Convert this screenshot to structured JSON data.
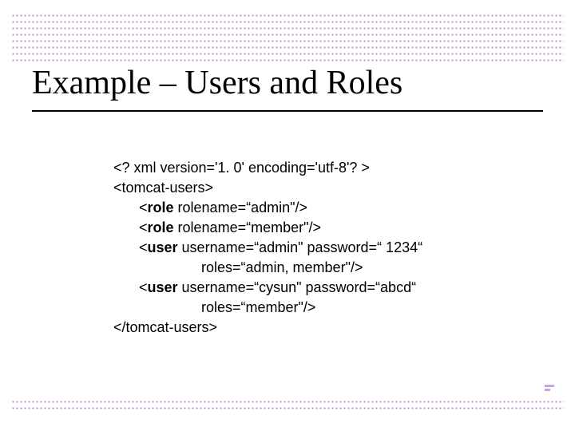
{
  "title": "Example – Users and Roles",
  "code": {
    "l1": "<? xml version='1. 0' encoding='utf-8'? >",
    "l2": "<tomcat-users>",
    "l3_pre": "<",
    "l3_b": "role",
    "l3_post": " rolename=“admin\"/>",
    "l4_pre": "<",
    "l4_b": "role",
    "l4_post": " rolename=“member\"/>",
    "l5_pre": "<",
    "l5_b": "user",
    "l5_post": " username=“admin\" password=“ 1234“",
    "l6": "roles=“admin, member\"/>",
    "l7_pre": "<",
    "l7_b": "user",
    "l7_post": " username=“cysun\" password=“abcd“",
    "l8": "roles=“member\"/>",
    "l9": "</tomcat-users>"
  }
}
